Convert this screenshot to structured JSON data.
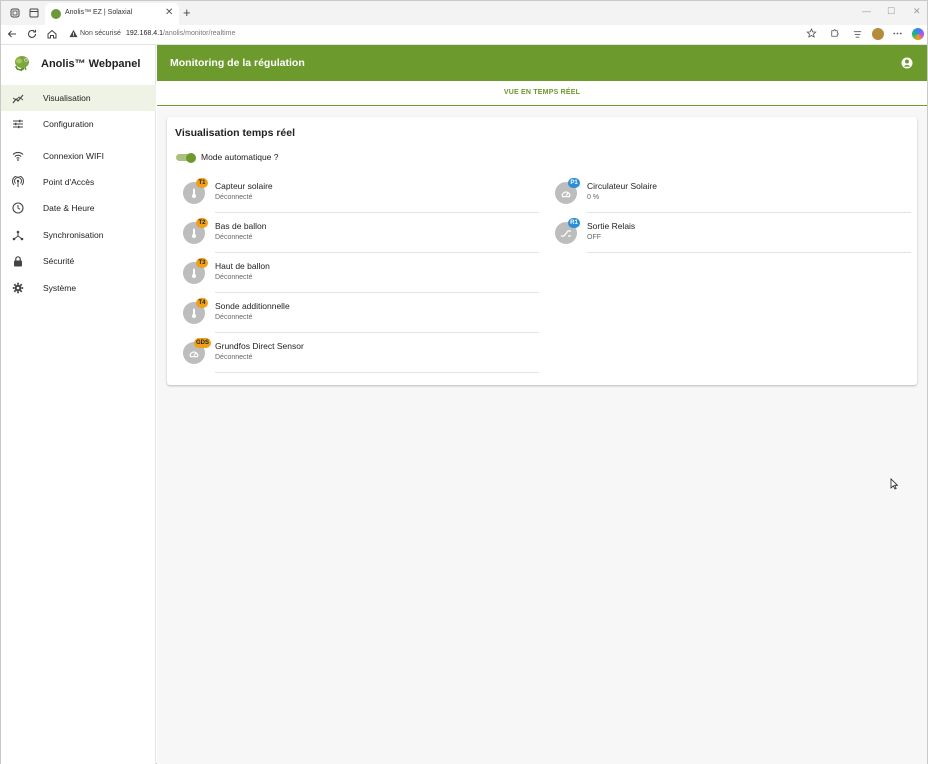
{
  "browser": {
    "tab_title": "Anolis™ EZ | Solaxial",
    "tab_close": "✕",
    "new_tab": "+",
    "security_label": "Non sécurisé",
    "url_host": "192.168.4.1",
    "url_path": "/anolis/monitor/realtime",
    "window_minimize": "—",
    "window_maximize": "☐",
    "window_close": "✕"
  },
  "app": {
    "brand": "Anolis™ Webpanel",
    "header_title": "Monitoring de la régulation",
    "subtab": "VUE EN TEMPS RÉEL",
    "accent_color": "#6c9a2c"
  },
  "sidebar": {
    "items": [
      {
        "label": "Visualisation",
        "icon": "chart-line-icon",
        "active": true
      },
      {
        "label": "Configuration",
        "icon": "tune-sliders-icon",
        "active": false
      },
      {
        "label": "Connexion WIFI",
        "icon": "wifi-icon",
        "active": false
      },
      {
        "label": "Point d'Accès",
        "icon": "access-point-icon",
        "active": false
      },
      {
        "label": "Date & Heure",
        "icon": "clock-icon",
        "active": false
      },
      {
        "label": "Synchronisation",
        "icon": "sync-network-icon",
        "active": false
      },
      {
        "label": "Sécurité",
        "icon": "lock-icon",
        "active": false
      },
      {
        "label": "Système",
        "icon": "gear-icon",
        "active": false
      }
    ]
  },
  "card": {
    "title": "Visualisation temps réel",
    "toggle_label": "Mode automatique ?",
    "toggle_on": true,
    "left_sensors": [
      {
        "badge": "T1",
        "name": "Capteur solaire",
        "status": "Déconnecté",
        "icon": "thermometer-icon",
        "badge_color": "orange"
      },
      {
        "badge": "T2",
        "name": "Bas de ballon",
        "status": "Déconnecté",
        "icon": "thermometer-icon",
        "badge_color": "orange"
      },
      {
        "badge": "T3",
        "name": "Haut de ballon",
        "status": "Déconnecté",
        "icon": "thermometer-icon",
        "badge_color": "orange"
      },
      {
        "badge": "T4",
        "name": "Sonde additionnelle",
        "status": "Déconnecté",
        "icon": "thermometer-icon",
        "badge_color": "orange"
      },
      {
        "badge": "GDS",
        "name": "Grundfos Direct Sensor",
        "status": "Déconnecté",
        "icon": "gauge-icon",
        "badge_color": "orange"
      }
    ],
    "right_sensors": [
      {
        "badge": "P1",
        "name": "Circulateur Solaire",
        "status": "0 %",
        "icon": "gauge-icon",
        "badge_color": "blue"
      },
      {
        "badge": "R1",
        "name": "Sortie Relais",
        "status": "OFF",
        "icon": "relay-icon",
        "badge_color": "blue"
      }
    ]
  }
}
